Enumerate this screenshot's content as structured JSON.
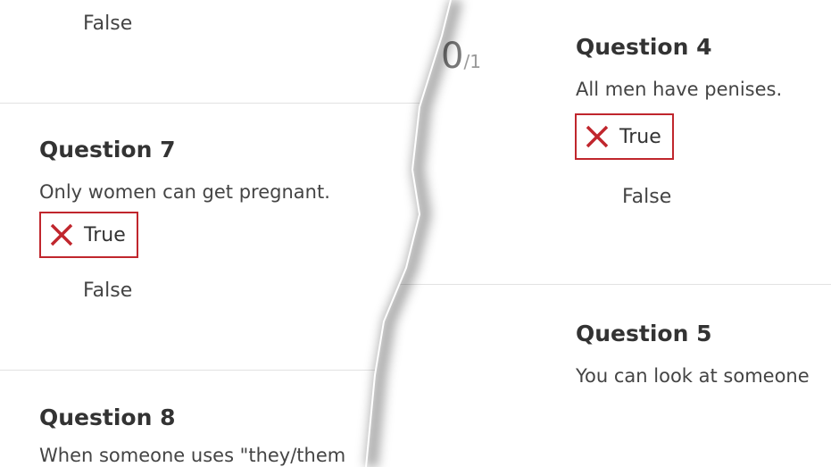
{
  "left": {
    "prev_false": "False",
    "q7": {
      "title": "Question 7",
      "text": "Only women can get pregnant.",
      "selected": "True",
      "other": "False"
    },
    "q8": {
      "title": "Question 8",
      "text": "When someone uses \"they/them"
    }
  },
  "right": {
    "score": "0",
    "score_total": "/1",
    "q4": {
      "title": "Question 4",
      "text": "All men have penises.",
      "selected": "True",
      "other": "False"
    },
    "q5": {
      "title": "Question 5",
      "text": "You can look at someone"
    }
  },
  "colors": {
    "wrong": "#c0262d",
    "divider": "#e2e2e2"
  },
  "icons": {
    "wrong_mark": "close-icon"
  }
}
